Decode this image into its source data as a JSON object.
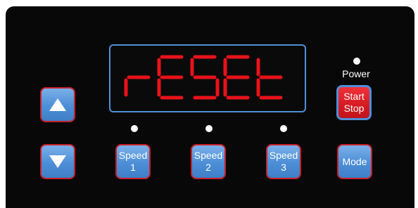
{
  "display": {
    "text": "rESEt",
    "segment_color": "#e8121b",
    "border_color": "#4f90d8"
  },
  "power": {
    "label": "Power"
  },
  "buttons": {
    "up": {
      "icon": "up-arrow-icon"
    },
    "down": {
      "icon": "down-arrow-icon"
    },
    "start_stop": {
      "line1": "Start",
      "line2": "Stop"
    },
    "speed1": {
      "line1": "Speed",
      "line2": "1"
    },
    "speed2": {
      "line1": "Speed",
      "line2": "2"
    },
    "speed3": {
      "line1": "Speed",
      "line2": "3"
    },
    "mode": {
      "label": "Mode"
    }
  },
  "colors": {
    "panel": "#080808",
    "button_blue": "#4c8ed7",
    "button_border_red": "#c8202a",
    "start_red": "#d51a22"
  }
}
